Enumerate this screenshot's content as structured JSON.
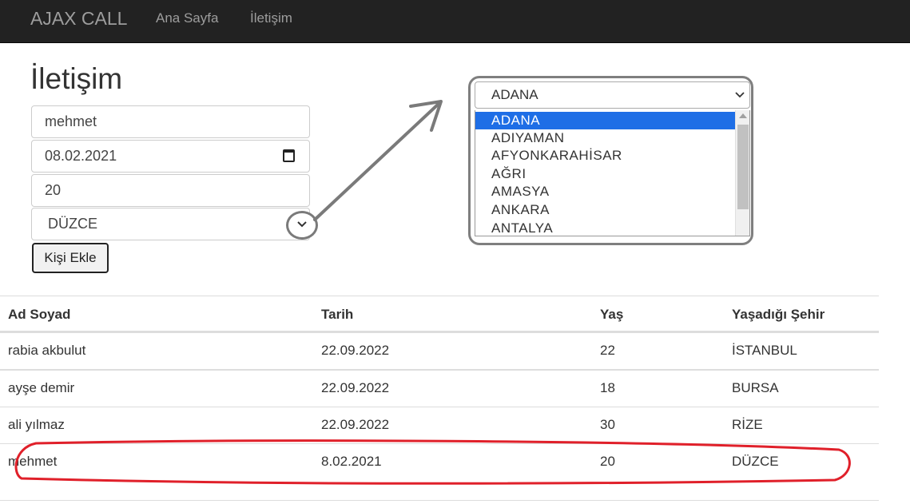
{
  "navbar": {
    "brand": "AJAX CALL",
    "links": [
      "Ana Sayfa",
      "İletişim"
    ]
  },
  "page": {
    "title": "İletişim"
  },
  "form": {
    "name_value": "mehmet",
    "date_value": "08.02.2021",
    "age_value": "20",
    "city_value": "DÜZCE",
    "submit_label": "Kişi Ekle"
  },
  "dropdown_zoom": {
    "selected": "ADANA",
    "options": [
      "ADANA",
      "ADIYAMAN",
      "AFYONKARAHİSAR",
      "AĞRI",
      "AMASYA",
      "ANKARA",
      "ANTALYA"
    ],
    "highlighted_index": 0
  },
  "table": {
    "headers": [
      "Ad Soyad",
      "Tarih",
      "Yaş",
      "Yaşadığı Şehir"
    ],
    "rows": [
      [
        "rabia akbulut",
        "22.09.2022",
        "22",
        "İSTANBUL"
      ],
      [
        "ayşe demir",
        "22.09.2022",
        "18",
        "BURSA"
      ],
      [
        "ali yılmaz",
        "22.09.2022",
        "30",
        "RİZE"
      ],
      [
        "mehmet",
        "8.02.2021",
        "20",
        "DÜZCE"
      ]
    ]
  },
  "colors": {
    "navbar_bg": "#222222",
    "nav_text": "#9d9d9d",
    "option_highlight": "#1e6ee6",
    "annotation_red": "#e0202a",
    "annotation_gray": "#7a7a7a"
  }
}
